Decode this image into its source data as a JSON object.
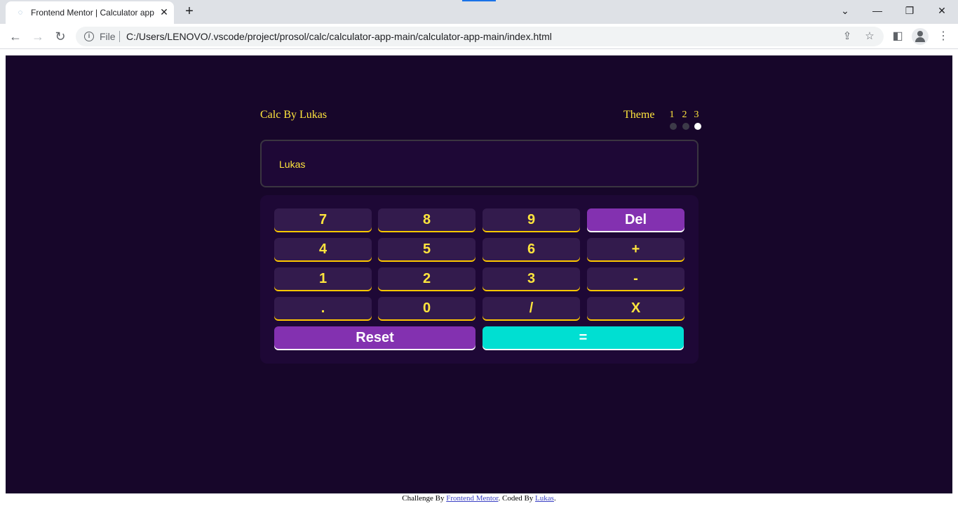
{
  "browser": {
    "tab_title": "Frontend Mentor | Calculator app",
    "tab_favicon": "frontend-mentor-favicon",
    "file_label": "File",
    "url": "C:/Users/LENOVO/.vscode/project/prosol/calc/calculator-app-main/calculator-app-main/index.html",
    "new_tab": "+",
    "close_tab": "✕"
  },
  "calc": {
    "brand": "Calc By Lukas",
    "theme_label": "Theme",
    "theme_numbers": [
      "1",
      "2",
      "3"
    ],
    "active_theme": 3,
    "display_value": "Lukas"
  },
  "keys": {
    "k7": "7",
    "k8": "8",
    "k9": "9",
    "del": "Del",
    "k4": "4",
    "k5": "5",
    "k6": "6",
    "plus": "+",
    "k1": "1",
    "k2": "2",
    "k3": "3",
    "minus": "-",
    "dot": ".",
    "k0": "0",
    "divide": "/",
    "multiply": "X",
    "reset": "Reset",
    "equals": "="
  },
  "footer": {
    "prefix": "Challenge By",
    "link1": "Frontend Mentor",
    "middle": ". Coded By",
    "link2": "Lukas",
    "suffix": "."
  },
  "colors": {
    "page_bg": "#17062a",
    "panel_bg": "#1e0836",
    "key_bg": "#331b4d",
    "key_text": "#ffe53d",
    "accent_purple": "#8331b0",
    "accent_cyan": "#00dfd2"
  }
}
